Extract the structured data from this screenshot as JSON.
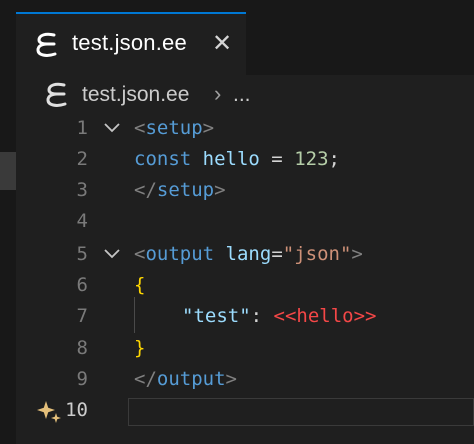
{
  "tab": {
    "title": "test.json.ee",
    "close": "✕"
  },
  "breadcrumb": {
    "file": "test.json.ee",
    "separator": "›",
    "more": "..."
  },
  "lines": [
    {
      "number": "1",
      "tokens": [
        "<",
        "setup",
        ">"
      ]
    },
    {
      "number": "2",
      "tokens": [
        "const",
        " ",
        "hello",
        " = ",
        "123",
        ";"
      ]
    },
    {
      "number": "3",
      "tokens": [
        "</",
        "setup",
        ">"
      ]
    },
    {
      "number": "4",
      "tokens": []
    },
    {
      "number": "5",
      "tokens": [
        "<",
        "output",
        " ",
        "lang",
        "=",
        "\"json\"",
        ">"
      ]
    },
    {
      "number": "6",
      "tokens": [
        "{"
      ]
    },
    {
      "number": "7",
      "tokens": [
        "\"test\"",
        ": ",
        "<<hello>>"
      ]
    },
    {
      "number": "8",
      "tokens": [
        "}"
      ]
    },
    {
      "number": "9",
      "tokens": [
        "</",
        "output",
        ">"
      ]
    },
    {
      "number": "10",
      "tokens": []
    }
  ],
  "icons": {
    "file": "ee-file-icon",
    "fold": "chevron-down-icon",
    "sparkle": "sparkle-icon",
    "close": "close-icon"
  },
  "colors": {
    "accent": "#0078d4",
    "tag": "#808080",
    "keyword": "#569cd6",
    "variable": "#9cdcfe",
    "number": "#b5cea8",
    "string": "#ce9178",
    "brace": "#ffd700",
    "interpolation": "#f44747",
    "sparkle": "#e5c07b"
  }
}
